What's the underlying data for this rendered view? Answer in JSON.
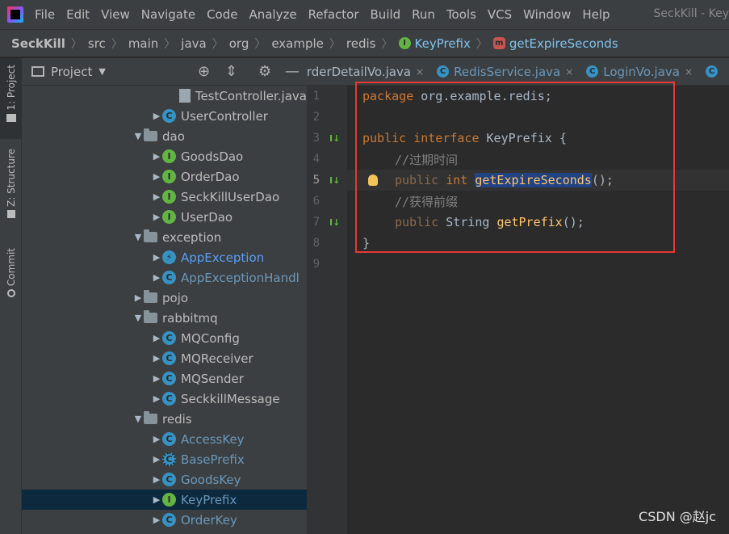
{
  "menubar": {
    "items": [
      "File",
      "Edit",
      "View",
      "Navigate",
      "Code",
      "Analyze",
      "Refactor",
      "Build",
      "Run",
      "Tools",
      "VCS",
      "Window",
      "Help"
    ],
    "window_title": "SeckKill - Key"
  },
  "breadcrumb": [
    "SeckKill",
    "src",
    "main",
    "java",
    "org",
    "example",
    "redis",
    "KeyPrefix",
    "getExpireSeconds"
  ],
  "toolstrip": {
    "project": "1: Project",
    "structure": "Z: Structure",
    "commit": "Commit"
  },
  "project_panel": {
    "title": "Project"
  },
  "tree": [
    {
      "label": "TestController.java",
      "icon": "file",
      "arrow": ""
    },
    {
      "label": "UserController",
      "icon": "C",
      "arrow": "▶"
    },
    {
      "label": "dao",
      "icon": "folder",
      "arrow": "▼"
    },
    {
      "label": "GoodsDao",
      "icon": "I",
      "arrow": "▶"
    },
    {
      "label": "OrderDao",
      "icon": "I",
      "arrow": "▶"
    },
    {
      "label": "SeckKillUserDao",
      "icon": "I",
      "arrow": "▶"
    },
    {
      "label": "UserDao",
      "icon": "I",
      "arrow": "▶"
    },
    {
      "label": "exception",
      "icon": "folder",
      "arrow": "▼"
    },
    {
      "label": "AppException",
      "icon": "E",
      "arrow": "▶"
    },
    {
      "label": "AppExceptionHandl",
      "icon": "C",
      "arrow": "▶"
    },
    {
      "label": "pojo",
      "icon": "folder",
      "arrow": "▶"
    },
    {
      "label": "rabbitmq",
      "icon": "folder",
      "arrow": "▼"
    },
    {
      "label": "MQConfig",
      "icon": "C",
      "arrow": "▶"
    },
    {
      "label": "MQReceiver",
      "icon": "C",
      "arrow": "▶"
    },
    {
      "label": "MQSender",
      "icon": "C",
      "arrow": "▶"
    },
    {
      "label": "SeckkillMessage",
      "icon": "C",
      "arrow": "▶"
    },
    {
      "label": "redis",
      "icon": "folder",
      "arrow": "▼"
    },
    {
      "label": "AccessKey",
      "icon": "C",
      "arrow": "▶"
    },
    {
      "label": "BasePrefix",
      "icon": "A",
      "arrow": "▶"
    },
    {
      "label": "GoodsKey",
      "icon": "C",
      "arrow": "▶"
    },
    {
      "label": "KeyPrefix",
      "icon": "I",
      "arrow": "▶"
    },
    {
      "label": "OrderKey",
      "icon": "C",
      "arrow": "▶"
    }
  ],
  "tabs": [
    "OrderDetailVo.java",
    "RedisService.java",
    "LoginVo.java"
  ],
  "code": {
    "line_numbers": [
      "1",
      "2",
      "3",
      "4",
      "5",
      "6",
      "7",
      "8",
      "9"
    ],
    "l1_kw": "package",
    "l1_rest": " org.example.redis;",
    "l3_kw1": "public",
    "l3_kw2": "interface",
    "l3_name": "KeyPrefix",
    "l3_rest": " {",
    "l4_comment": "//过期时间",
    "l5_kw1": "public",
    "l5_kw2": "int",
    "l5_fn": "getExpireSeconds",
    "l5_rest": "();",
    "l6_comment": "//获得前缀",
    "l7_kw1": "public",
    "l7_type": "String",
    "l7_fn": "getPrefix",
    "l7_rest": "();",
    "l8_text": "}"
  },
  "watermark": "CSDN @赵jc"
}
